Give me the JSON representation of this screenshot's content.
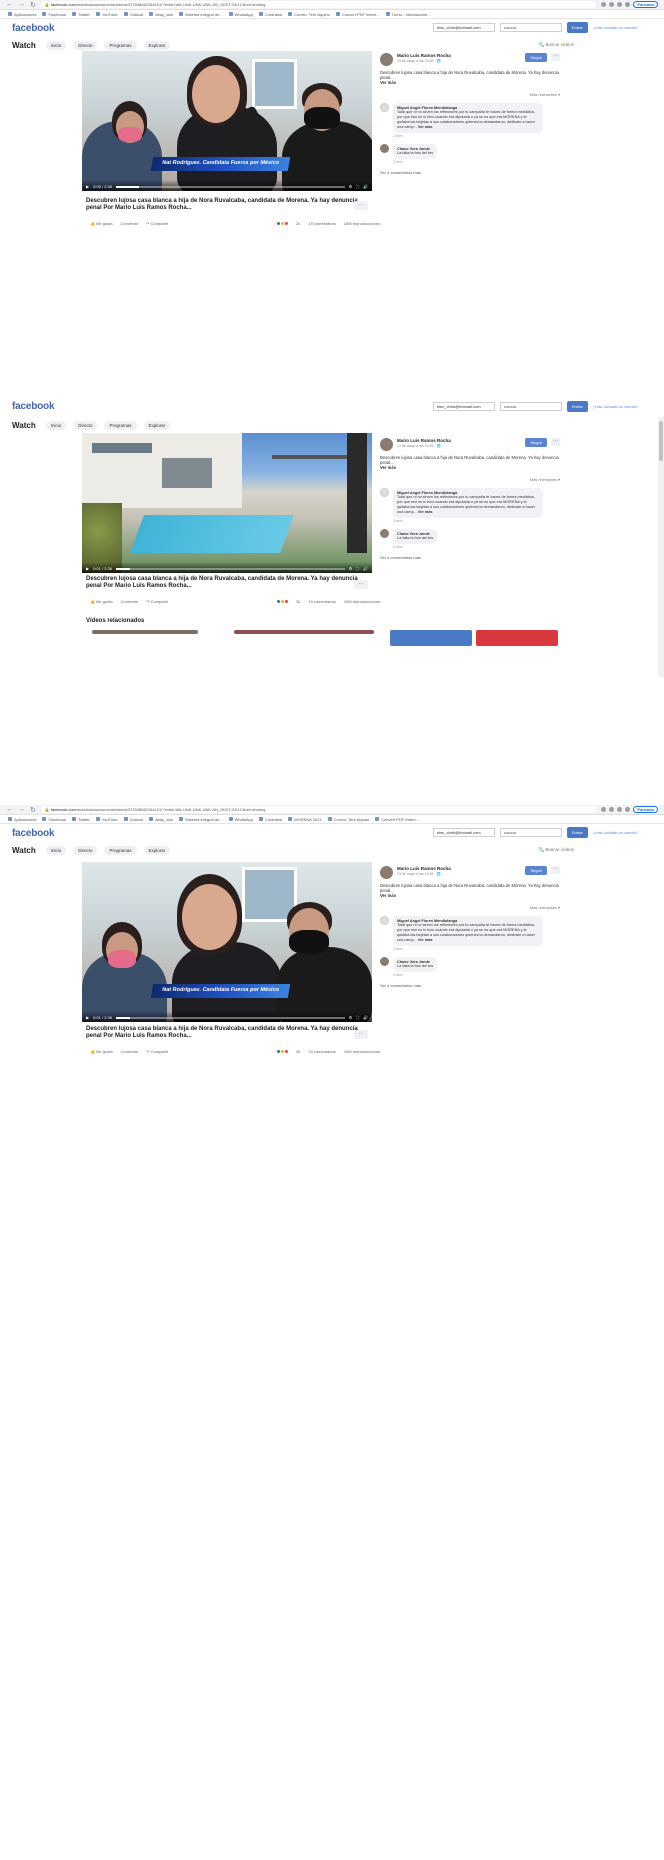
{
  "browser": {
    "url_domain": "facebook.com",
    "url_path": "/marioluisramosrocha/videos/372548082184101/?extid=WA-UNK-UNK-UNK-AN_GK0T-GK1C&ref=sharing",
    "profile_label": "Pausado",
    "bookmarks": [
      "Aplicaciones",
      "Facebook",
      "Twitter",
      "YouTube",
      "Outlook",
      "abay_dan",
      "Sistema integral de...",
      "WhatsApp",
      "Contratos",
      "MORENA 2021",
      "Correo: Tere Aquino",
      "Convert PDF Intern...",
      "Turno - Introduccion..."
    ]
  },
  "header": {
    "logo": "facebook",
    "email_value": "elec_chrik@hotmail.com",
    "password_value": "•••••••••",
    "enter_label": "Entrar",
    "forgot_label": "¿Has olvidado la cuenta?"
  },
  "watchbar": {
    "title": "Watch",
    "tabs": [
      "Inicio",
      "Directo",
      "Programas",
      "Explorar"
    ],
    "search_placeholder": "Buscar vídeos"
  },
  "video": {
    "lower_third": "Nat Rodríguez. Candidata Fuerza por México",
    "time_a": "0:05 / 2:36",
    "time_b": "0:01 / 2:36",
    "caption_a": "Descubren lujosa casa blanca a hija de Nora Ruvalcaba, candidata de Morena. Ya hay denuncia penal Por Mario Luis Ramos Rocha...",
    "more": "…",
    "like": "Me gusta",
    "comment": "Comentar",
    "share": "Compartir",
    "reaction_count": "2k",
    "comments_count": "19 comentarios",
    "views_count": "16M reproducciones",
    "progress_a": 0.1,
    "progress_b": 0.06
  },
  "sidebar": {
    "author": "Mario Luis Ramos Rocha",
    "date": "13 de mayo a las 10:36 · 🌐",
    "follow": "Seguir",
    "description": "Descubren lujosa casa blanca a hija de Nora Ruvalcaba, candidata de Morena. Ya hay denuncia penal...",
    "see_more": "Ver más",
    "relevance": "Más relevantes ▾",
    "comment1_name": "Miguel Angel Flores Mendiolanga",
    "comment1_text": "Total que ni no sirven los reflectores por tu campaña te haces de forma mediática, por que eso es lo hizo cuando era diputada o ya se es que era MORENA y le quitaba las tarjetas a sus colaboradores quienes la demandaron, dedicate a hacer una camp...",
    "comment1_more": "Ver más",
    "comment2_name": "Chavo Vera Jonde",
    "comment2_text": "La falta la foto del tes",
    "comment_meta": "2 sem",
    "view_comments": "Ver 4 comentarios más"
  },
  "related": {
    "title": "Vídeos relacionados"
  }
}
